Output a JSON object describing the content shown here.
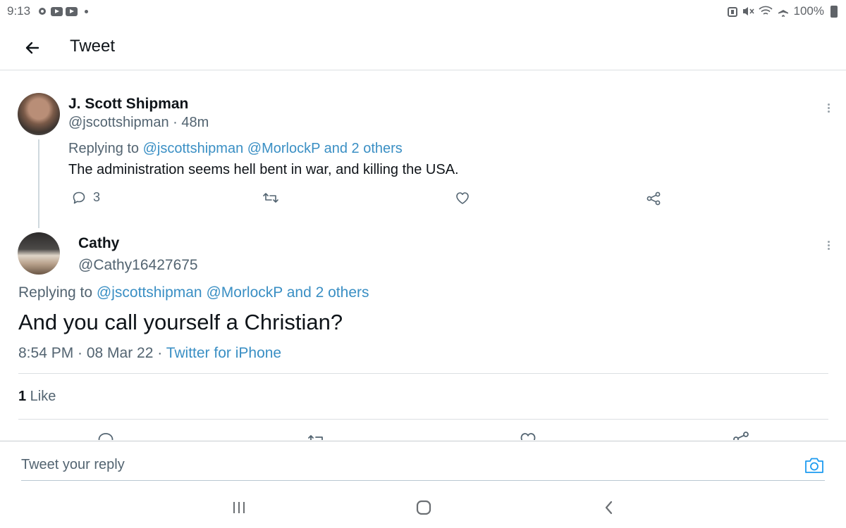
{
  "status_bar": {
    "time": "9:13",
    "battery": "100%"
  },
  "header": {
    "title": "Tweet"
  },
  "parent_tweet": {
    "name": "J. Scott Shipman",
    "handle": "@jscottshipman · 48m",
    "replying_prefix": "Replying to ",
    "replying_mentions": "@jscottshipman @MorlockP and 2 others",
    "text": "The administration seems hell bent in war, and killing the USA.",
    "reply_count": "3"
  },
  "main_tweet": {
    "name": "Cathy",
    "handle": "@Cathy16427675",
    "replying_prefix": "Replying to ",
    "replying_mentions": "@jscottshipman @MorlockP and 2 others",
    "text": "And you call yourself a Christian?",
    "timestamp": "8:54 PM · 08 Mar 22 · ",
    "source": "Twitter for iPhone",
    "like_count": "1",
    "like_label": " Like"
  },
  "reply_bar": {
    "placeholder": "Tweet your reply"
  },
  "colors": {
    "link": "#1d9bf0",
    "secondary_text": "#536471",
    "divider": "#dcdfe2"
  },
  "icons": {
    "back": "arrow-left-icon",
    "reply": "reply-icon",
    "retweet": "retweet-icon",
    "like": "heart-icon",
    "share": "share-icon",
    "more": "more-vertical-icon",
    "camera": "camera-icon",
    "recents": "recents-icon",
    "home": "home-icon",
    "nav_back": "nav-back-icon"
  }
}
